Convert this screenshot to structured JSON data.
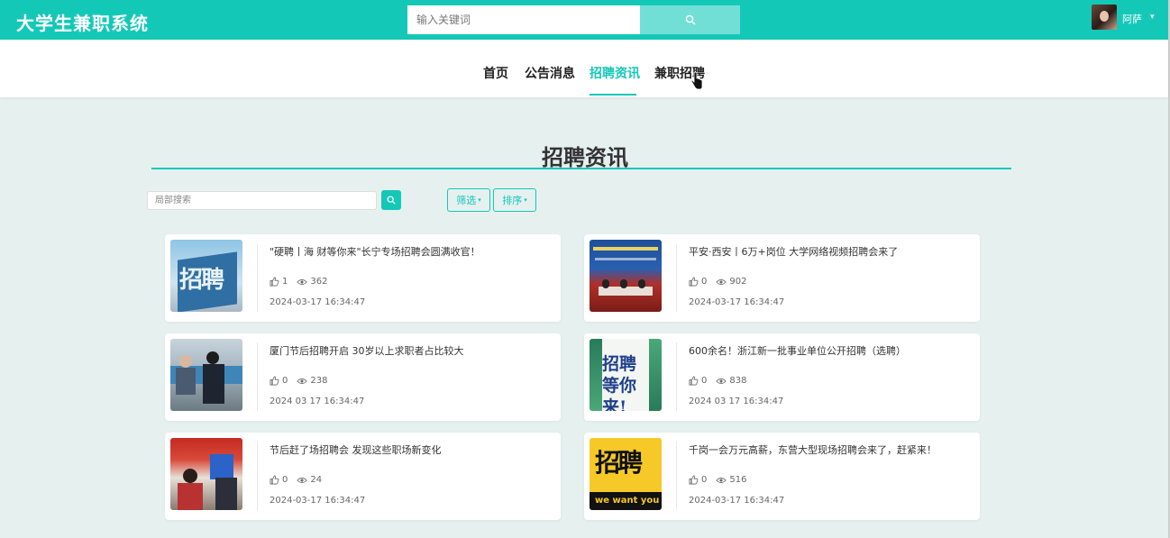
{
  "header": {
    "brand": "大学生兼职系统",
    "search_placeholder": "输入关键词",
    "username": "阿萨",
    "user_caret": "▾",
    "search_icon": "search-icon"
  },
  "nav": {
    "items": [
      {
        "label": "首页"
      },
      {
        "label": "公告消息"
      },
      {
        "label": "招聘资讯",
        "active": true
      },
      {
        "label": "兼职招聘"
      }
    ]
  },
  "section": {
    "title": "招聘资讯",
    "local_search_placeholder": "局部搜索",
    "filter_label": "筛选",
    "sort_label": "排序",
    "caret": "▾"
  },
  "articles": [
    {
      "title": "\"硬聘丨海 财等你来\"长宁专场招聘会圆满收官！",
      "likes": "1",
      "views": "362",
      "date": "2024-03-17 16:34:47",
      "thumb_text": "招聘"
    },
    {
      "title": "平安·西安丨6万+岗位 大学网络视频招聘会来了",
      "likes": "0",
      "views": "902",
      "date": "2024-03-17 16:34:47",
      "thumb_text": ""
    },
    {
      "title": "厦门节后招聘开启 30岁以上求职者占比较大",
      "likes": "0",
      "views": "238",
      "date": "2024 03 17 16:34:47",
      "thumb_text": ""
    },
    {
      "title": "600余名！浙江新一批事业单位公开招聘（选聘）",
      "likes": "0",
      "views": "838",
      "date": "2024 03 17 16:34:47",
      "thumb_text": "招聘等你来!"
    },
    {
      "title": "节后赶了场招聘会 发现这些职场新变化",
      "likes": "0",
      "views": "24",
      "date": "2024-03-17 16:34:47",
      "thumb_text": ""
    },
    {
      "title": "千岗一会万元高薪，东营大型现场招聘会来了，赶紧来！",
      "likes": "0",
      "views": "516",
      "date": "2024-03-17 16:34:47",
      "thumb_text": "招聘",
      "thumb_sub": "we want you"
    }
  ],
  "colors": {
    "accent": "#14c8b8",
    "page_bg": "#e6f0ef"
  }
}
